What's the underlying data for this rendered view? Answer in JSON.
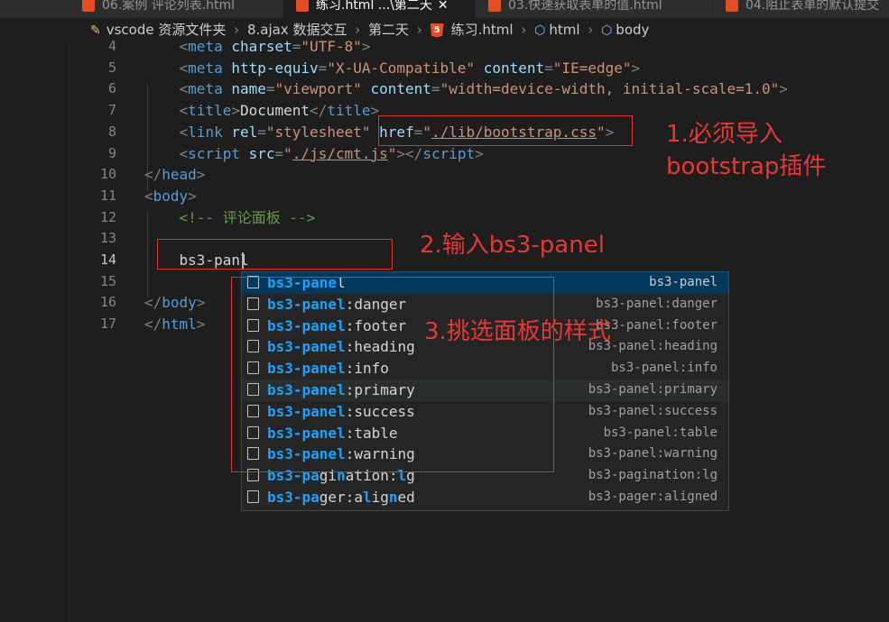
{
  "tabs": [
    {
      "label": "06.案例 评论列表.html",
      "active": false
    },
    {
      "label": "练习.html ...\\第二天",
      "active": true
    },
    {
      "label": "03.快速获取表单的值.html",
      "active": false
    },
    {
      "label": "04.阻止表单的默认提交",
      "active": false
    }
  ],
  "breadcrumb": {
    "items": [
      "vscode 资源文件夹",
      "8.ajax 数据交互",
      "第二天",
      "练习.html",
      "html",
      "body"
    ],
    "file_badge": "5"
  },
  "editor": {
    "line_numbers": [
      "4",
      "5",
      "6",
      "7",
      "8",
      "9",
      "10",
      "11",
      "12",
      "13",
      "14",
      "15",
      "16",
      "17"
    ],
    "current_line": "14",
    "lines": [
      [
        [
          "pu",
          "    <"
        ],
        [
          "tg",
          "meta "
        ],
        [
          "at",
          "charset"
        ],
        [
          "pu",
          "="
        ],
        [
          "st",
          "\"UTF-8\""
        ],
        [
          "pu",
          ">"
        ]
      ],
      [
        [
          "pu",
          "    <"
        ],
        [
          "tg",
          "meta "
        ],
        [
          "at",
          "http-equiv"
        ],
        [
          "pu",
          "="
        ],
        [
          "st",
          "\"X-UA-Compatible\""
        ],
        [
          "tx",
          " "
        ],
        [
          "at",
          "content"
        ],
        [
          "pu",
          "="
        ],
        [
          "st",
          "\"IE=edge\""
        ],
        [
          "pu",
          ">"
        ]
      ],
      [
        [
          "pu",
          "    <"
        ],
        [
          "tg",
          "meta "
        ],
        [
          "at",
          "name"
        ],
        [
          "pu",
          "="
        ],
        [
          "st",
          "\"viewport\""
        ],
        [
          "tx",
          " "
        ],
        [
          "at",
          "content"
        ],
        [
          "pu",
          "="
        ],
        [
          "st",
          "\"width=device-width, initial-scale=1.0\""
        ],
        [
          "pu",
          ">"
        ]
      ],
      [
        [
          "pu",
          "    <"
        ],
        [
          "tg",
          "title"
        ],
        [
          "pu",
          ">"
        ],
        [
          "tx",
          "Document"
        ],
        [
          "pu",
          "</"
        ],
        [
          "tg",
          "title"
        ],
        [
          "pu",
          ">"
        ]
      ],
      [
        [
          "pu",
          "    <"
        ],
        [
          "tg",
          "link "
        ],
        [
          "at",
          "rel"
        ],
        [
          "pu",
          "="
        ],
        [
          "st",
          "\"stylesheet\""
        ],
        [
          "tx",
          " "
        ],
        [
          "at",
          "href"
        ],
        [
          "pu",
          "="
        ],
        [
          "st",
          "\""
        ],
        [
          "stu",
          "./lib/bootstrap.css"
        ],
        [
          "st",
          "\""
        ],
        [
          "pu",
          ">"
        ]
      ],
      [
        [
          "pu",
          "    <"
        ],
        [
          "tg",
          "script "
        ],
        [
          "at",
          "src"
        ],
        [
          "pu",
          "="
        ],
        [
          "st",
          "\""
        ],
        [
          "stu",
          "./js/cmt.js"
        ],
        [
          "st",
          "\""
        ],
        [
          "pu",
          "></"
        ],
        [
          "tg",
          "script"
        ],
        [
          "pu",
          ">"
        ]
      ],
      [
        [
          "pu",
          "</"
        ],
        [
          "tg",
          "head"
        ],
        [
          "pu",
          ">"
        ]
      ],
      [
        [
          "pu",
          "<"
        ],
        [
          "tg",
          "body"
        ],
        [
          "pu",
          ">"
        ]
      ],
      [
        [
          "cm",
          "    <!-- 评论面板 -->"
        ]
      ],
      [
        [
          "tx",
          ""
        ]
      ],
      [
        [
          "tx",
          "    bs3-panl"
        ]
      ],
      [
        [
          "tx",
          ""
        ]
      ],
      [
        [
          "pu",
          "</"
        ],
        [
          "tg",
          "body"
        ],
        [
          "pu",
          ">"
        ]
      ],
      [
        [
          "pu",
          "</"
        ],
        [
          "tg",
          "html"
        ],
        [
          "pu",
          ">"
        ]
      ]
    ]
  },
  "annotations": {
    "step1_line1": "1.必须导入",
    "step1_line2": "bootstrap插件",
    "step2": "2.输入bs3-panel",
    "step3": "3.挑选面板的样式"
  },
  "suggestions": [
    {
      "match": "bs3-pane",
      "rest": "l",
      "detail": "bs3-panel",
      "state": "selected"
    },
    {
      "match": "bs3-panel",
      "rest": ":danger",
      "detail": "bs3-panel:danger",
      "state": ""
    },
    {
      "match": "bs3-panel",
      "rest": ":footer",
      "detail": "bs3-panel:footer",
      "state": ""
    },
    {
      "match": "bs3-panel",
      "rest": ":heading",
      "detail": "bs3-panel:heading",
      "state": ""
    },
    {
      "match": "bs3-panel",
      "rest": ":info",
      "detail": "bs3-panel:info",
      "state": ""
    },
    {
      "match": "bs3-panel",
      "rest": ":primary",
      "detail": "bs3-panel:primary",
      "state": "hover"
    },
    {
      "match": "bs3-panel",
      "rest": ":success",
      "detail": "bs3-panel:success",
      "state": ""
    },
    {
      "match": "bs3-panel",
      "rest": ":table",
      "detail": "bs3-panel:table",
      "state": ""
    },
    {
      "match": "bs3-panel",
      "rest": ":warning",
      "detail": "bs3-panel:warning",
      "state": ""
    },
    {
      "segments": [
        [
          "m",
          "bs3-pa"
        ],
        [
          "t",
          "gi"
        ],
        [
          "m",
          "n"
        ],
        [
          "t",
          "ation:"
        ],
        [
          "m",
          "l"
        ],
        [
          "t",
          "g"
        ]
      ],
      "detail": "bs3-pagination:lg",
      "state": ""
    },
    {
      "segments": [
        [
          "m",
          "bs3-pa"
        ],
        [
          "t",
          "ger:a"
        ],
        [
          "m",
          "l"
        ],
        [
          "t",
          "ig"
        ],
        [
          "m",
          "n"
        ],
        [
          "t",
          "ed"
        ]
      ],
      "detail": "bs3-pager:aligned",
      "state": ""
    }
  ],
  "colors": {
    "editor_bg": "#1e1e1e",
    "accent_match": "#18a3ff",
    "annotation_red": "#e53935",
    "selection_bg": "#04395e"
  }
}
